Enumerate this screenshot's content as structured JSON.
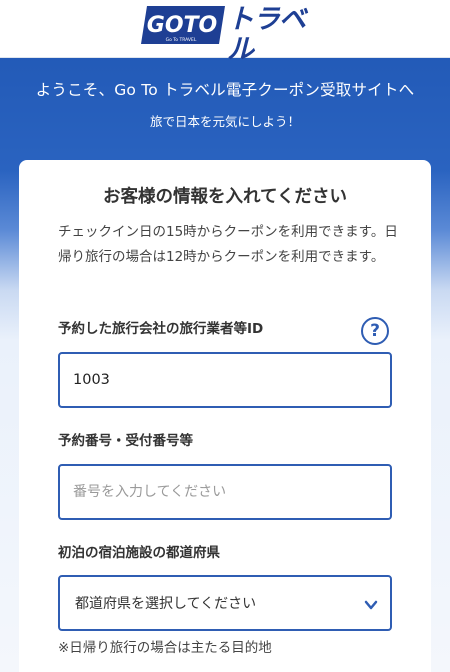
{
  "header": {
    "logo_goto": "GOTO",
    "logo_subtext": "Go To TRAVEL",
    "logo_kana": "トラベル"
  },
  "banner": {
    "welcome": "ようこそ、Go To トラベル電子クーポン受取サイトへ",
    "tagline": "旅で日本を元気にしよう！"
  },
  "form": {
    "title": "お客様の情報を入れてください",
    "notice": "チェックイン日の15時からクーポンを利用できます。日帰り旅行の場合は12時からクーポンを利用できます。",
    "agency_id": {
      "label": "予約した旅行会社の旅行業者等ID",
      "value": "1003",
      "help_icon": "?"
    },
    "reservation_number": {
      "label": "予約番号・受付番号等",
      "placeholder": "番号を入力してください"
    },
    "prefecture": {
      "label": "初泊の宿泊施設の都道府県",
      "selected": "都道府県を選択してください"
    },
    "day_trip_note": "※日帰り旅行の場合は主たる目的地"
  },
  "colors": {
    "brand_blue": "#1f56b3",
    "field_border": "#2f5db3",
    "logo_navy": "#1e3f94"
  }
}
